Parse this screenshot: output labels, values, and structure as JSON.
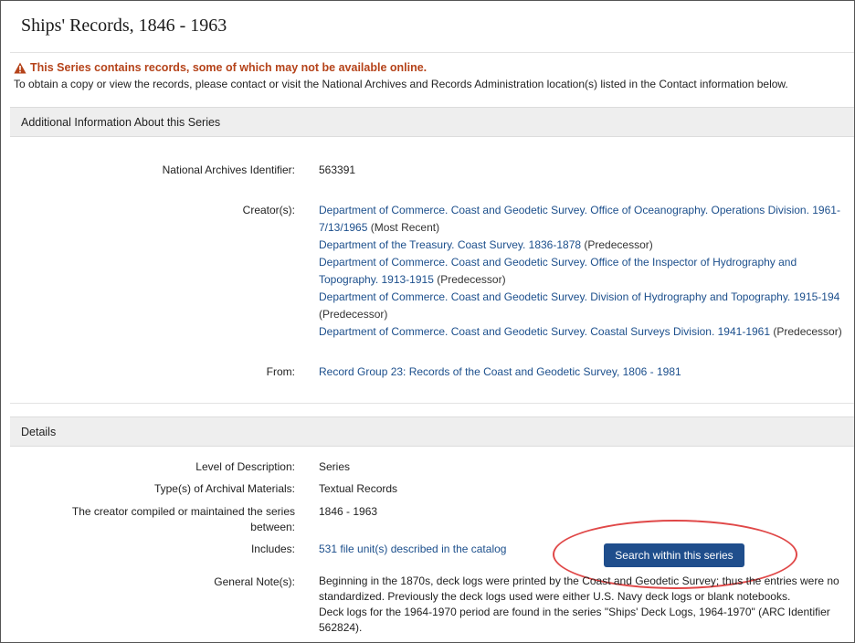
{
  "page": {
    "title": "Ships' Records, 1846 - 1963"
  },
  "availability": {
    "warning": "This Series contains records, some of which may not be available online.",
    "notice": "To obtain a copy or view the records, please contact or visit the National Archives and Records Administration location(s) listed in the Contact information below."
  },
  "additional_info": {
    "header": "Additional Information About this Series",
    "identifier_label": "National Archives Identifier:",
    "identifier_value": "563391",
    "creators_label": "Creator(s):",
    "creators": [
      {
        "line1": "Department of Commerce. Coast and Geodetic Survey. Office of Oceanography. Operations Division. 1961-",
        "line2": "7/13/1965",
        "role": "(Most Recent)"
      },
      {
        "line1": "Department of the Treasury. Coast Survey. 1836-1878",
        "role": "(Predecessor)"
      },
      {
        "line1": "Department of Commerce. Coast and Geodetic Survey. Office of the Inspector of Hydrography and",
        "line2": "Topography. 1913-1915",
        "role": "(Predecessor)"
      },
      {
        "line1": "Department of Commerce. Coast and Geodetic Survey. Division of Hydrography and Topography. 1915-194",
        "role": "(Predecessor)"
      },
      {
        "line1": "Department of Commerce. Coast and Geodetic Survey. Coastal Surveys Division. 1941-1961",
        "role": "(Predecessor)"
      }
    ],
    "from_label": "From:",
    "from_value": "Record Group 23: Records of the Coast and Geodetic Survey, 1806 - 1981"
  },
  "details": {
    "header": "Details",
    "level_label": "Level of Description:",
    "level_value": "Series",
    "type_label": "Type(s) of Archival Materials:",
    "type_value": "Textual Records",
    "compiled_label_1": "The creator compiled or maintained the series",
    "compiled_label_2": "between:",
    "compiled_value": "1846 - 1963",
    "includes_label": "Includes:",
    "includes_value": "531 file unit(s) described in the catalog",
    "search_button": "Search within this series",
    "note_label": "General Note(s):",
    "note_lines": [
      "Beginning in the 1870s, deck logs were printed by the Coast and Geodetic Survey; thus the entries were no",
      "standardized. Previously the deck logs used were either U.S. Navy deck logs or blank notebooks.",
      "Deck logs for the 1964-1970 period are found in the series \"Ships' Deck Logs, 1964-1970\" (ARC Identifier",
      "562824)."
    ]
  },
  "colors": {
    "link": "#1c4f8c",
    "warning": "#b5431a",
    "button": "#1f4e8c",
    "highlight": "#e04848"
  }
}
